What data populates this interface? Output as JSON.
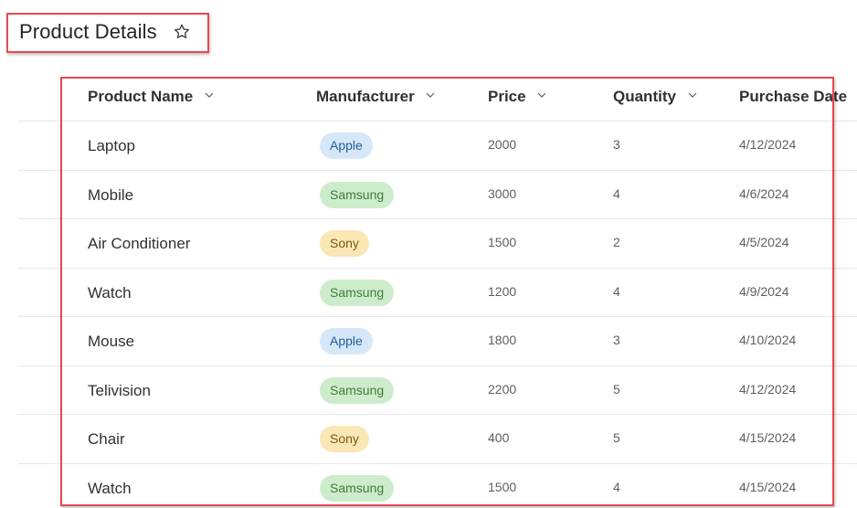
{
  "header": {
    "title": "Product Details"
  },
  "columns": [
    {
      "label": "Product Name"
    },
    {
      "label": "Manufacturer"
    },
    {
      "label": "Price"
    },
    {
      "label": "Quantity"
    },
    {
      "label": "Purchase Date"
    }
  ],
  "rows": [
    {
      "name": "Laptop",
      "manufacturer": "Apple",
      "price": "2000",
      "quantity": "3",
      "date": "4/12/2024"
    },
    {
      "name": "Mobile",
      "manufacturer": "Samsung",
      "price": "3000",
      "quantity": "4",
      "date": "4/6/2024"
    },
    {
      "name": "Air Conditioner",
      "manufacturer": "Sony",
      "price": "1500",
      "quantity": "2",
      "date": "4/5/2024"
    },
    {
      "name": "Watch",
      "manufacturer": "Samsung",
      "price": "1200",
      "quantity": "4",
      "date": "4/9/2024"
    },
    {
      "name": "Mouse",
      "manufacturer": "Apple",
      "price": "1800",
      "quantity": "3",
      "date": "4/10/2024"
    },
    {
      "name": "Telivision",
      "manufacturer": "Samsung",
      "price": "2200",
      "quantity": "5",
      "date": "4/12/2024"
    },
    {
      "name": "Chair",
      "manufacturer": "Sony",
      "price": "400",
      "quantity": "5",
      "date": "4/15/2024"
    },
    {
      "name": "Watch",
      "manufacturer": "Samsung",
      "price": "1500",
      "quantity": "4",
      "date": "4/15/2024"
    }
  ],
  "colors": {
    "highlight_border": "#e8484f",
    "apple_pill": "#d6e8f8",
    "samsung_pill": "#cdeccb",
    "sony_pill": "#fbe7b5"
  },
  "icons": {
    "favorite": "star-icon",
    "sort": "chevron-down-icon"
  }
}
